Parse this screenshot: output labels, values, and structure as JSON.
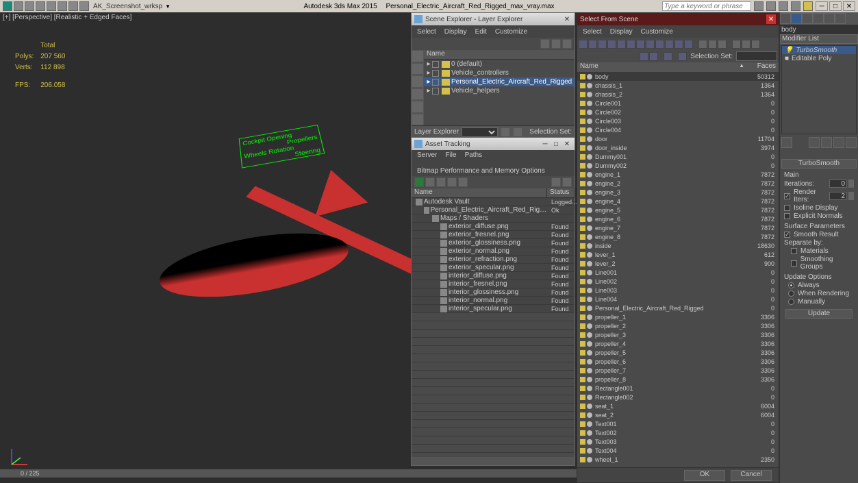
{
  "titlebar": {
    "workspace": "AK_Screenshot_wrksp",
    "app": "Autodesk 3ds Max  2015",
    "file": "Personal_Electric_Aircraft_Red_Rigged_max_vray.max",
    "search_placeholder": "Type a keyword or phrase"
  },
  "viewport": {
    "label": "[+] [Perspective] [Realistic + Edged Faces]",
    "stats": {
      "total_label": "Total",
      "polys_label": "Polys:",
      "polys": "207 560",
      "verts_label": "Verts:",
      "verts": "112 898",
      "fps_label": "FPS:",
      "fps": "206.058"
    },
    "green_labels": [
      "Cockpit Opening",
      "Propellers",
      "Wheels Rotation",
      "Steering"
    ],
    "slider": "0 / 225"
  },
  "scene_explorer": {
    "title": "Scene Explorer - Layer Explorer",
    "menu": [
      "Select",
      "Display",
      "Edit",
      "Customize"
    ],
    "tree_header": "Name",
    "tree": [
      {
        "label": "0 (default)",
        "indent": 0
      },
      {
        "label": "Vehicle_controllers",
        "indent": 0
      },
      {
        "label": "Personal_Electric_Aircraft_Red_Rigged",
        "indent": 0,
        "selected": true
      },
      {
        "label": "Vehicle_helpers",
        "indent": 0
      }
    ],
    "layer_label": "Layer Explorer",
    "selection_label": "Selection Set:"
  },
  "asset_tracking": {
    "title": "Asset Tracking",
    "menu": [
      "Server",
      "File",
      "Paths",
      "Bitmap Performance and Memory Options"
    ],
    "headers": {
      "name": "Name",
      "status": "Status"
    },
    "tree": [
      {
        "label": "Autodesk Vault",
        "status": "Logged...",
        "indent": 0,
        "icon": "vault"
      },
      {
        "label": "Personal_Electric_Aircraft_Red_Rigged_max_vra...",
        "status": "Ok",
        "indent": 1,
        "icon": "file"
      },
      {
        "label": "Maps / Shaders",
        "status": "",
        "indent": 2,
        "icon": "folder"
      },
      {
        "label": "exterior_diffuse.png",
        "status": "Found",
        "indent": 3,
        "icon": "img"
      },
      {
        "label": "exterior_fresnel.png",
        "status": "Found",
        "indent": 3,
        "icon": "img"
      },
      {
        "label": "exterior_glossiness.png",
        "status": "Found",
        "indent": 3,
        "icon": "img"
      },
      {
        "label": "exterior_normal.png",
        "status": "Found",
        "indent": 3,
        "icon": "img"
      },
      {
        "label": "exterior_refraction.png",
        "status": "Found",
        "indent": 3,
        "icon": "img"
      },
      {
        "label": "exterior_specular.png",
        "status": "Found",
        "indent": 3,
        "icon": "img"
      },
      {
        "label": "interior_diffuse.png",
        "status": "Found",
        "indent": 3,
        "icon": "img"
      },
      {
        "label": "interior_fresnel.png",
        "status": "Found",
        "indent": 3,
        "icon": "img"
      },
      {
        "label": "interior_glossiness.png",
        "status": "Found",
        "indent": 3,
        "icon": "img"
      },
      {
        "label": "interior_normal.png",
        "status": "Found",
        "indent": 3,
        "icon": "img"
      },
      {
        "label": "interior_specular.png",
        "status": "Found",
        "indent": 3,
        "icon": "img"
      }
    ]
  },
  "select_from_scene": {
    "title": "Select From Scene",
    "menu": [
      "Select",
      "Display",
      "Customize"
    ],
    "selection_label": "Selection Set:",
    "headers": {
      "name": "Name",
      "faces": "Faces"
    },
    "rows": [
      {
        "name": "body",
        "faces": "50312",
        "selected": true
      },
      {
        "name": "chassis_1",
        "faces": "1364"
      },
      {
        "name": "chassis_2",
        "faces": "1364"
      },
      {
        "name": "Circle001",
        "faces": "0"
      },
      {
        "name": "Circle002",
        "faces": "0"
      },
      {
        "name": "Circle003",
        "faces": "0"
      },
      {
        "name": "Circle004",
        "faces": "0"
      },
      {
        "name": "door",
        "faces": "11704"
      },
      {
        "name": "door_inside",
        "faces": "3974"
      },
      {
        "name": "Dummy001",
        "faces": "0"
      },
      {
        "name": "Dummy002",
        "faces": "0"
      },
      {
        "name": "engine_1",
        "faces": "7872"
      },
      {
        "name": "engine_2",
        "faces": "7872"
      },
      {
        "name": "engine_3",
        "faces": "7872"
      },
      {
        "name": "engine_4",
        "faces": "7872"
      },
      {
        "name": "engine_5",
        "faces": "7872"
      },
      {
        "name": "engine_6",
        "faces": "7872"
      },
      {
        "name": "engine_7",
        "faces": "7872"
      },
      {
        "name": "engine_8",
        "faces": "7872"
      },
      {
        "name": "inside",
        "faces": "18630"
      },
      {
        "name": "lever_1",
        "faces": "612"
      },
      {
        "name": "lever_2",
        "faces": "900"
      },
      {
        "name": "Line001",
        "faces": "0"
      },
      {
        "name": "Line002",
        "faces": "0"
      },
      {
        "name": "Line003",
        "faces": "0"
      },
      {
        "name": "Line004",
        "faces": "0"
      },
      {
        "name": "Personal_Electric_Aircraft_Red_Rigged",
        "faces": "0"
      },
      {
        "name": "propeller_1",
        "faces": "3306"
      },
      {
        "name": "propeller_2",
        "faces": "3306"
      },
      {
        "name": "propeller_3",
        "faces": "3306"
      },
      {
        "name": "propeller_4",
        "faces": "3306"
      },
      {
        "name": "propeller_5",
        "faces": "3306"
      },
      {
        "name": "propeller_6",
        "faces": "3306"
      },
      {
        "name": "propeller_7",
        "faces": "3306"
      },
      {
        "name": "propeller_8",
        "faces": "3306"
      },
      {
        "name": "Rectangle001",
        "faces": "0"
      },
      {
        "name": "Rectangle002",
        "faces": "0"
      },
      {
        "name": "seat_1",
        "faces": "6004"
      },
      {
        "name": "seat_2",
        "faces": "6004"
      },
      {
        "name": "Text001",
        "faces": "0"
      },
      {
        "name": "Text002",
        "faces": "0"
      },
      {
        "name": "Text003",
        "faces": "0"
      },
      {
        "name": "Text004",
        "faces": "0"
      },
      {
        "name": "wheel_1",
        "faces": "2350"
      }
    ],
    "ok": "OK",
    "cancel": "Cancel"
  },
  "right_panel": {
    "selected_object": "body",
    "modifier_label": "Modifier List",
    "stack": [
      {
        "label": "TurboSmooth",
        "icon": "bulb",
        "italic": true
      },
      {
        "label": "Editable Poly",
        "icon": "box"
      }
    ],
    "rollout_title": "TurboSmooth",
    "main_label": "Main",
    "iterations_label": "Iterations:",
    "iterations_value": "0",
    "render_iters_label": "Render Iters:",
    "render_iters_value": "2",
    "render_iters_checked": true,
    "isoline_label": "Isoline Display",
    "explicit_label": "Explicit Normals",
    "surface_label": "Surface Parameters",
    "smooth_result_label": "Smooth Result",
    "smooth_result_checked": true,
    "separate_label": "Separate by:",
    "materials_label": "Materials",
    "smoothing_groups_label": "Smoothing Groups",
    "update_label": "Update Options",
    "always_label": "Always",
    "when_rendering_label": "When Rendering",
    "manually_label": "Manually",
    "update_btn": "Update"
  }
}
